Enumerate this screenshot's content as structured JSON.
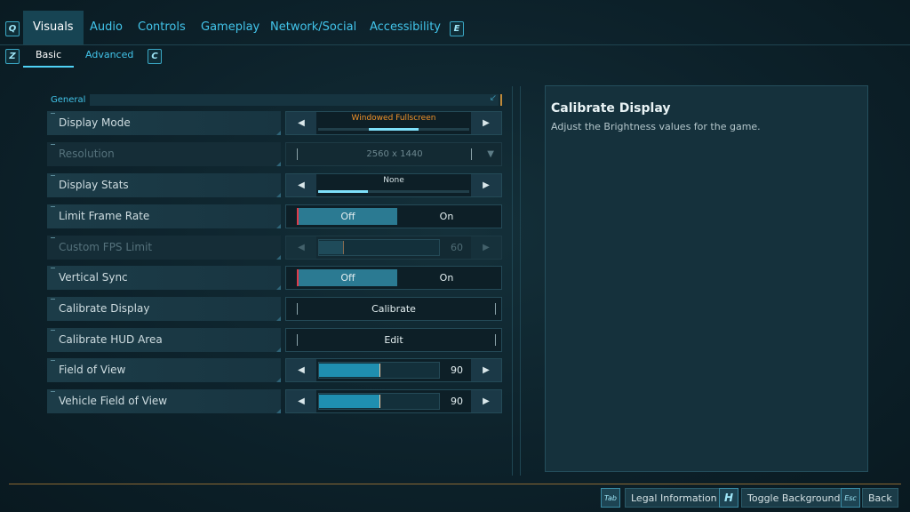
{
  "tabs": {
    "left_key": "Q",
    "right_key": "E",
    "items": [
      {
        "label": "Visuals",
        "active": true
      },
      {
        "label": "Audio"
      },
      {
        "label": "Controls"
      },
      {
        "label": "Gameplay"
      },
      {
        "label": "Network/Social"
      },
      {
        "label": "Accessibility"
      }
    ]
  },
  "subtabs": {
    "left_key": "Z",
    "right_key": "C",
    "items": [
      {
        "label": "Basic",
        "active": true
      },
      {
        "label": "Advanced"
      }
    ]
  },
  "section": {
    "label": "General"
  },
  "settings": {
    "display_mode": {
      "label": "Display Mode",
      "value": "Windowed Fullscreen",
      "position": 0.5
    },
    "resolution": {
      "label": "Resolution",
      "value": "2560 x 1440",
      "disabled": true
    },
    "display_stats": {
      "label": "Display Stats",
      "value": "None",
      "position": 0.0
    },
    "limit_frame_rate": {
      "label": "Limit Frame Rate",
      "off_label": "Off",
      "on_label": "On",
      "selected": "Off"
    },
    "custom_fps_limit": {
      "label": "Custom FPS Limit",
      "value": "60",
      "fill": 0.2,
      "disabled": true
    },
    "vertical_sync": {
      "label": "Vertical Sync",
      "off_label": "Off",
      "on_label": "On",
      "selected": "Off"
    },
    "calibrate_display": {
      "label": "Calibrate Display",
      "button": "Calibrate"
    },
    "calibrate_hud": {
      "label": "Calibrate HUD Area",
      "button": "Edit"
    },
    "fov": {
      "label": "Field of View",
      "value": "90",
      "fill": 0.5
    },
    "vehicle_fov": {
      "label": "Vehicle Field of View",
      "value": "90",
      "fill": 0.5
    }
  },
  "info": {
    "title": "Calibrate Display",
    "description": "Adjust the Brightness values for the game."
  },
  "footer": {
    "legal_key": "Tab",
    "legal_label": "Legal Information",
    "bg_key": "H",
    "bg_label": "Toggle Background",
    "back_key": "Esc",
    "back_label": "Back"
  },
  "colors": {
    "accent": "#42c4ea",
    "warning": "#f0922a",
    "toggle_marker": "#e03a4a"
  }
}
